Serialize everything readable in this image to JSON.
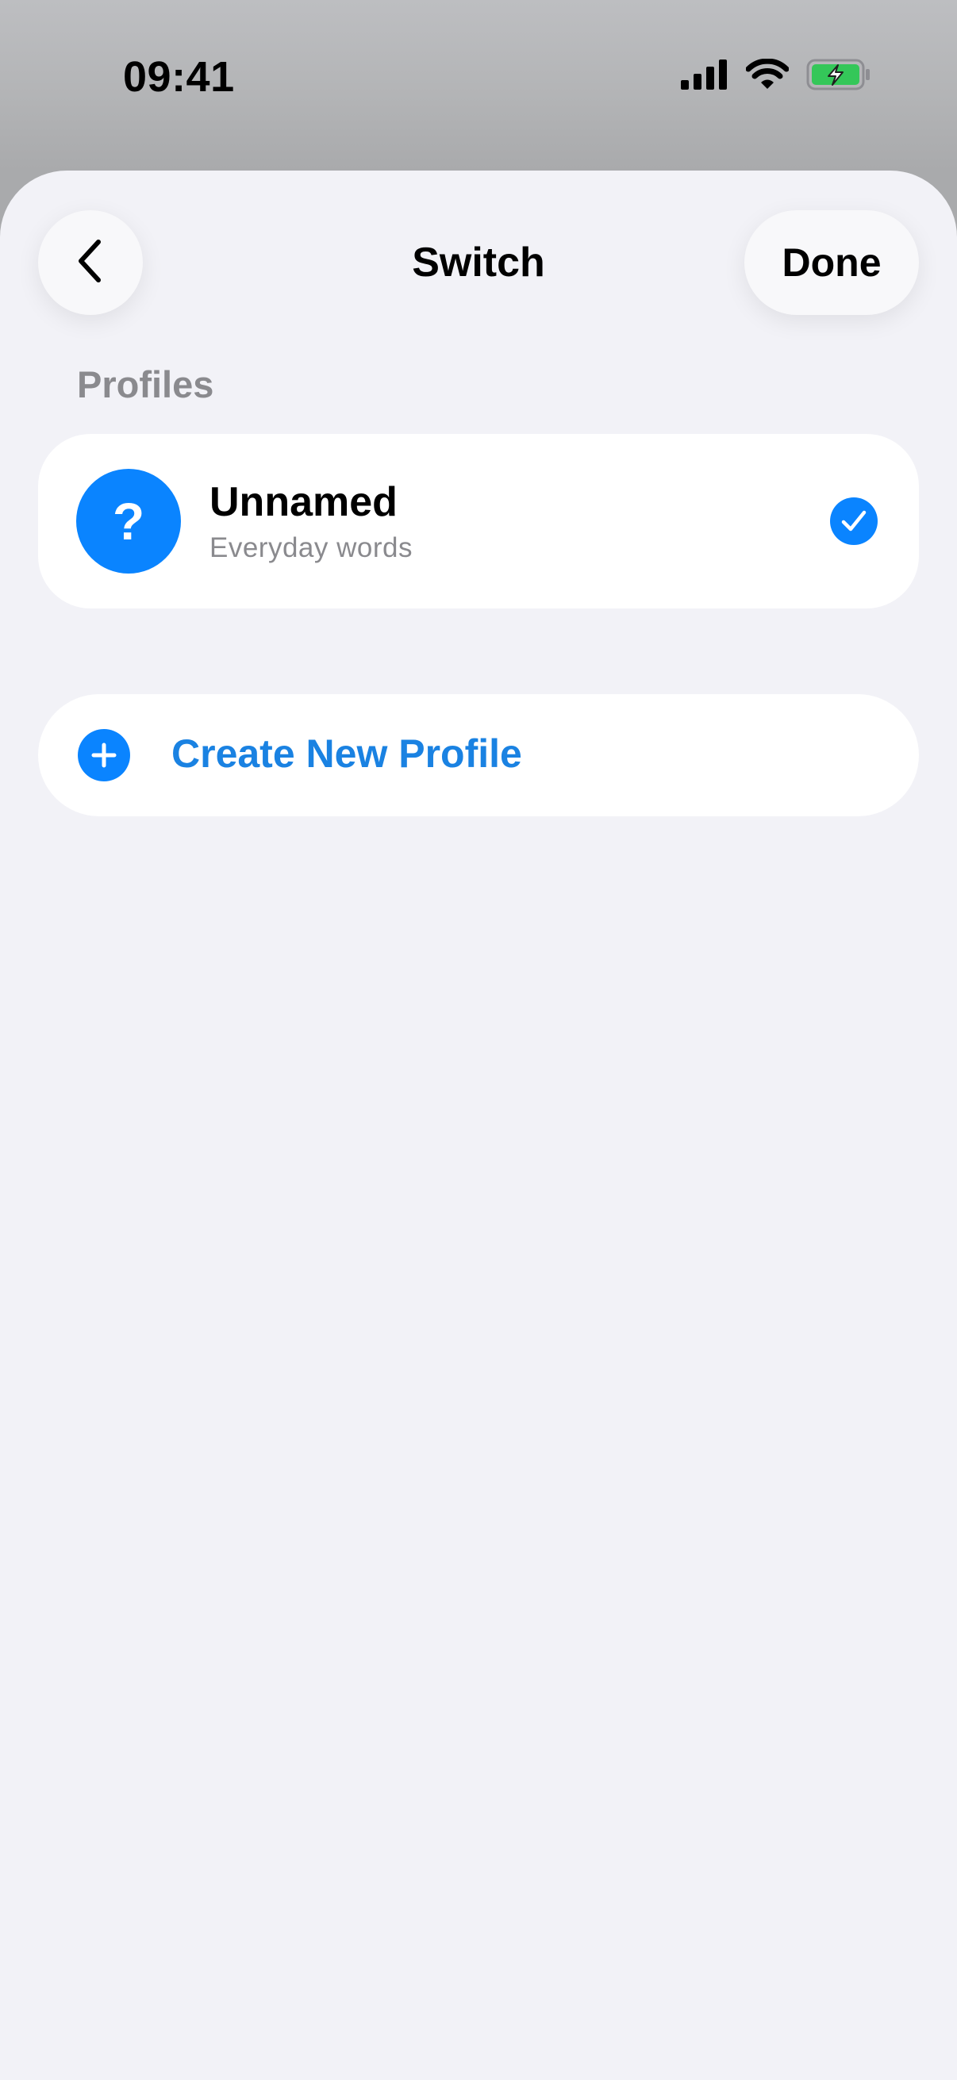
{
  "status_bar": {
    "time": "09:41",
    "icons": [
      "cellular-signal-icon",
      "wifi-icon",
      "battery-charging-icon"
    ]
  },
  "nav": {
    "title": "Switch",
    "done_label": "Done",
    "back_icon": "chevron-left-icon"
  },
  "profiles": {
    "header": "Profiles",
    "items": [
      {
        "name": "Unnamed",
        "subtitle": "Everyday words",
        "avatar_glyph": "?",
        "selected": true
      }
    ]
  },
  "create": {
    "label": "Create New Profile",
    "icon": "plus-circle-icon"
  },
  "colors": {
    "accent": "#0a84ff",
    "link": "#1a82e2",
    "sheet_bg": "#f2f2f7",
    "secondary_text": "#8a8a8e",
    "battery_green": "#34c759"
  }
}
